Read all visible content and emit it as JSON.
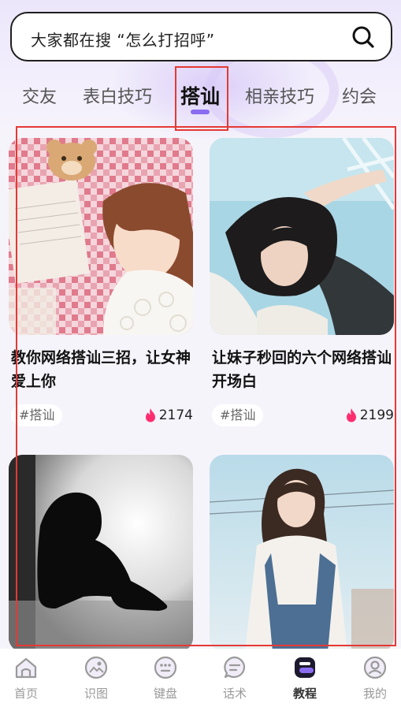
{
  "search": {
    "text": "大家都在搜 “怎么打招呼”"
  },
  "tabs": [
    {
      "label": "交友"
    },
    {
      "label": "表白技巧"
    },
    {
      "label": "搭讪"
    },
    {
      "label": "相亲技巧"
    },
    {
      "label": "约会"
    }
  ],
  "active_tab_index": 2,
  "cards": [
    {
      "title": "教你网络搭讪三招，让女神爱上你",
      "tag": "#搭讪",
      "likes": "2174"
    },
    {
      "title": "让妹子秒回的六个网络搭讪开场白",
      "tag": "#搭讪",
      "likes": "2199"
    },
    {
      "title": "",
      "tag": "",
      "likes": ""
    },
    {
      "title": "",
      "tag": "",
      "likes": ""
    }
  ],
  "nav": [
    {
      "label": "首页",
      "icon": "home-icon"
    },
    {
      "label": "识图",
      "icon": "image-recognize-icon"
    },
    {
      "label": "键盘",
      "icon": "keyboard-icon"
    },
    {
      "label": "话术",
      "icon": "chat-icon"
    },
    {
      "label": "教程",
      "icon": "tutorial-icon"
    },
    {
      "label": "我的",
      "icon": "profile-icon"
    }
  ],
  "active_nav_index": 4,
  "colors": {
    "accent": "#8a6cf0",
    "highlight": "#e53935",
    "like": "#ff2d6f"
  }
}
